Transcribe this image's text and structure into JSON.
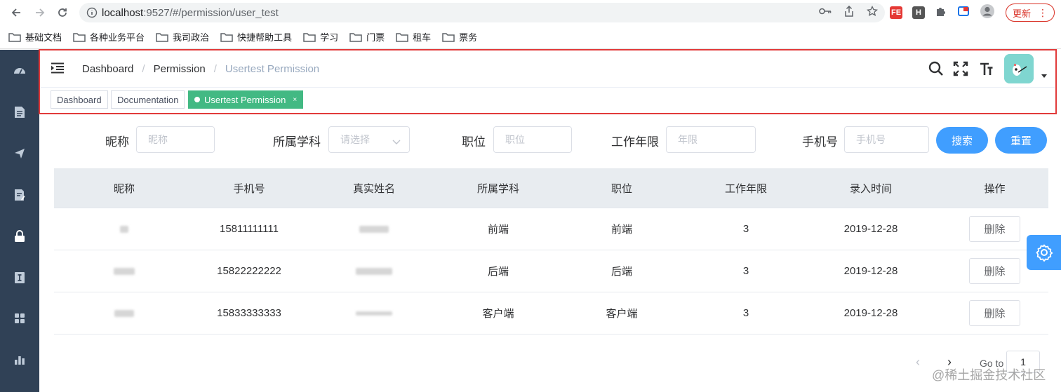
{
  "browser": {
    "url_host": "localhost",
    "url_path": ":9527/#/permission/user_test",
    "update_label": "更新",
    "bookmarks": [
      "基础文档",
      "各种业务平台",
      "我司政治",
      "快捷帮助工具",
      "学习",
      "门票",
      "租车",
      "票务"
    ]
  },
  "breadcrumb": {
    "items": [
      "Dashboard",
      "Permission",
      "Usertest Permission"
    ]
  },
  "tags": [
    "Dashboard",
    "Documentation",
    "Usertest Permission"
  ],
  "tag_close": "×",
  "search_form": {
    "nickname_label": "昵称",
    "nickname_placeholder": "昵称",
    "subject_label": "所属学科",
    "subject_placeholder": "请选择",
    "position_label": "职位",
    "position_placeholder": "职位",
    "years_label": "工作年限",
    "years_placeholder": "年限",
    "phone_label": "手机号",
    "phone_placeholder": "手机号",
    "search_button": "搜索",
    "reset_button": "重置"
  },
  "table": {
    "headers": [
      "昵称",
      "手机号",
      "真实姓名",
      "所属学科",
      "职位",
      "工作年限",
      "录入时间",
      "操作"
    ],
    "rows": [
      {
        "phone": "15811111111",
        "subject": "前端",
        "position": "前端",
        "years": "3",
        "date": "2019-12-28",
        "action": "删除"
      },
      {
        "phone": "15822222222",
        "subject": "后端",
        "position": "后端",
        "years": "3",
        "date": "2019-12-28",
        "action": "删除"
      },
      {
        "phone": "15833333333",
        "subject": "客户端",
        "position": "客户端",
        "years": "3",
        "date": "2019-12-28",
        "action": "删除"
      }
    ]
  },
  "pagination": {
    "prev": "‹",
    "next": "›",
    "goto_label": "Go to",
    "goto_value": "1"
  },
  "watermark": "@稀土掘金技术社区",
  "colors": {
    "sidebar": "#304156",
    "primary": "#409eff",
    "tag_active": "#42b983",
    "highlight_frame": "#e13a3a"
  }
}
